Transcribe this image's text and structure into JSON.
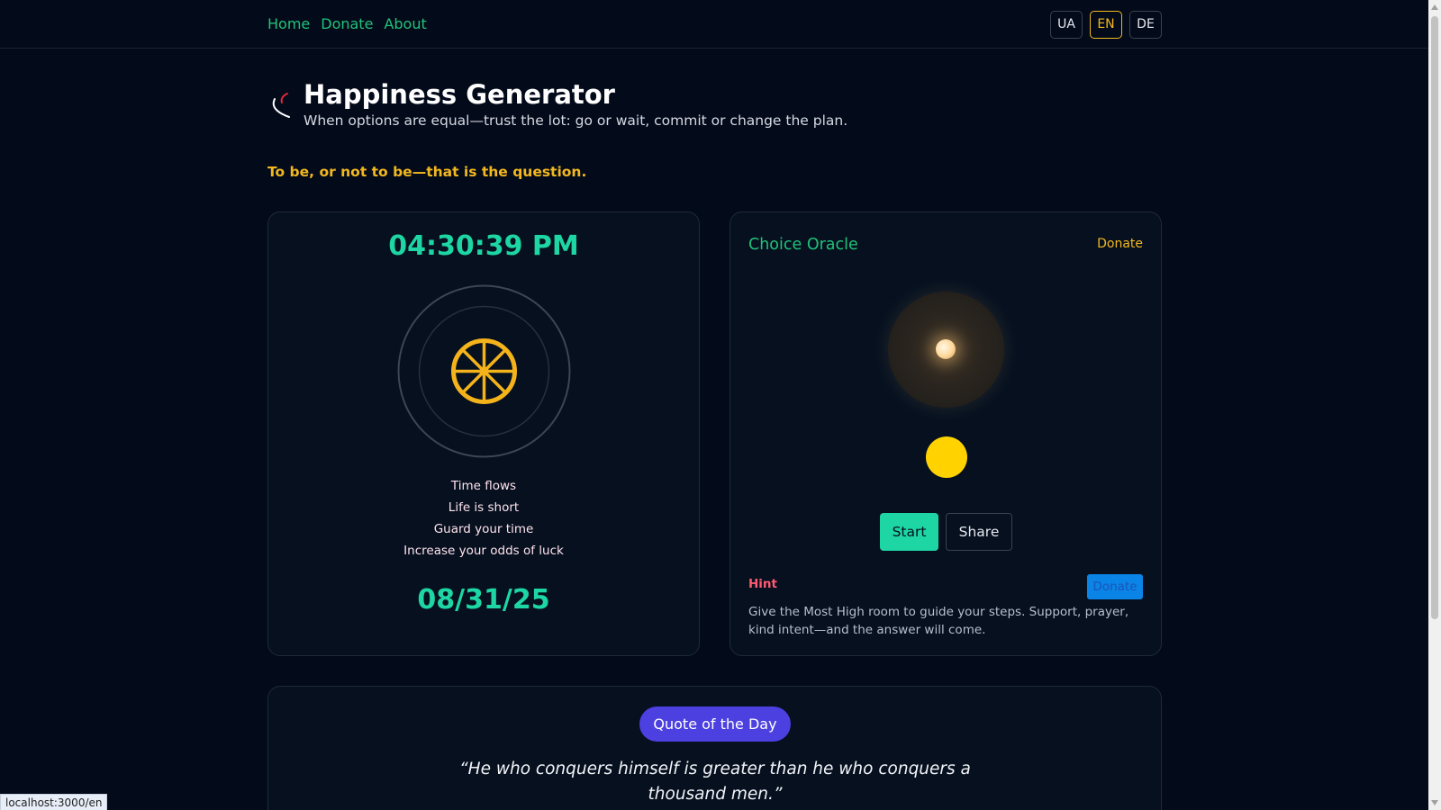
{
  "nav": {
    "links": [
      "Home",
      "Donate",
      "About"
    ],
    "languages": [
      "UA",
      "EN",
      "DE"
    ],
    "active_language": "EN"
  },
  "hero": {
    "title": "Happiness Generator",
    "subtitle": "When options are equal—trust the lot: go or wait, commit or change the plan.",
    "icon": "logo-arc-icon"
  },
  "tagline": "To be, or not to be—that is the question.",
  "clock_card": {
    "time": "04:30:39 PM",
    "wheel_icon": "dharma-wheel-icon",
    "lines": [
      "Time flows",
      "Life is short",
      "Guard your time",
      "Increase your odds of luck"
    ],
    "date": "08/31/25"
  },
  "oracle_card": {
    "title": "Choice Oracle",
    "donate_link": "Donate",
    "start_label": "Start",
    "share_label": "Share",
    "hint_label": "Hint",
    "hint_donate": "Donate",
    "hint_text": "Give the Most High room to guide your steps. Support, prayer, kind intent—and the answer will come."
  },
  "quote_card": {
    "badge": "Quote of the Day",
    "quote": "“He who conquers himself is greater than he who conquers a thousand men.”"
  },
  "status_url": "localhost:3000/en",
  "colors": {
    "background": "#030a1a",
    "accent_green": "#21c27a",
    "accent_teal": "#1ed6a4",
    "accent_gold": "#f3b81f",
    "hint_red": "#ff5a72",
    "quote_badge": "#4c40e0"
  }
}
